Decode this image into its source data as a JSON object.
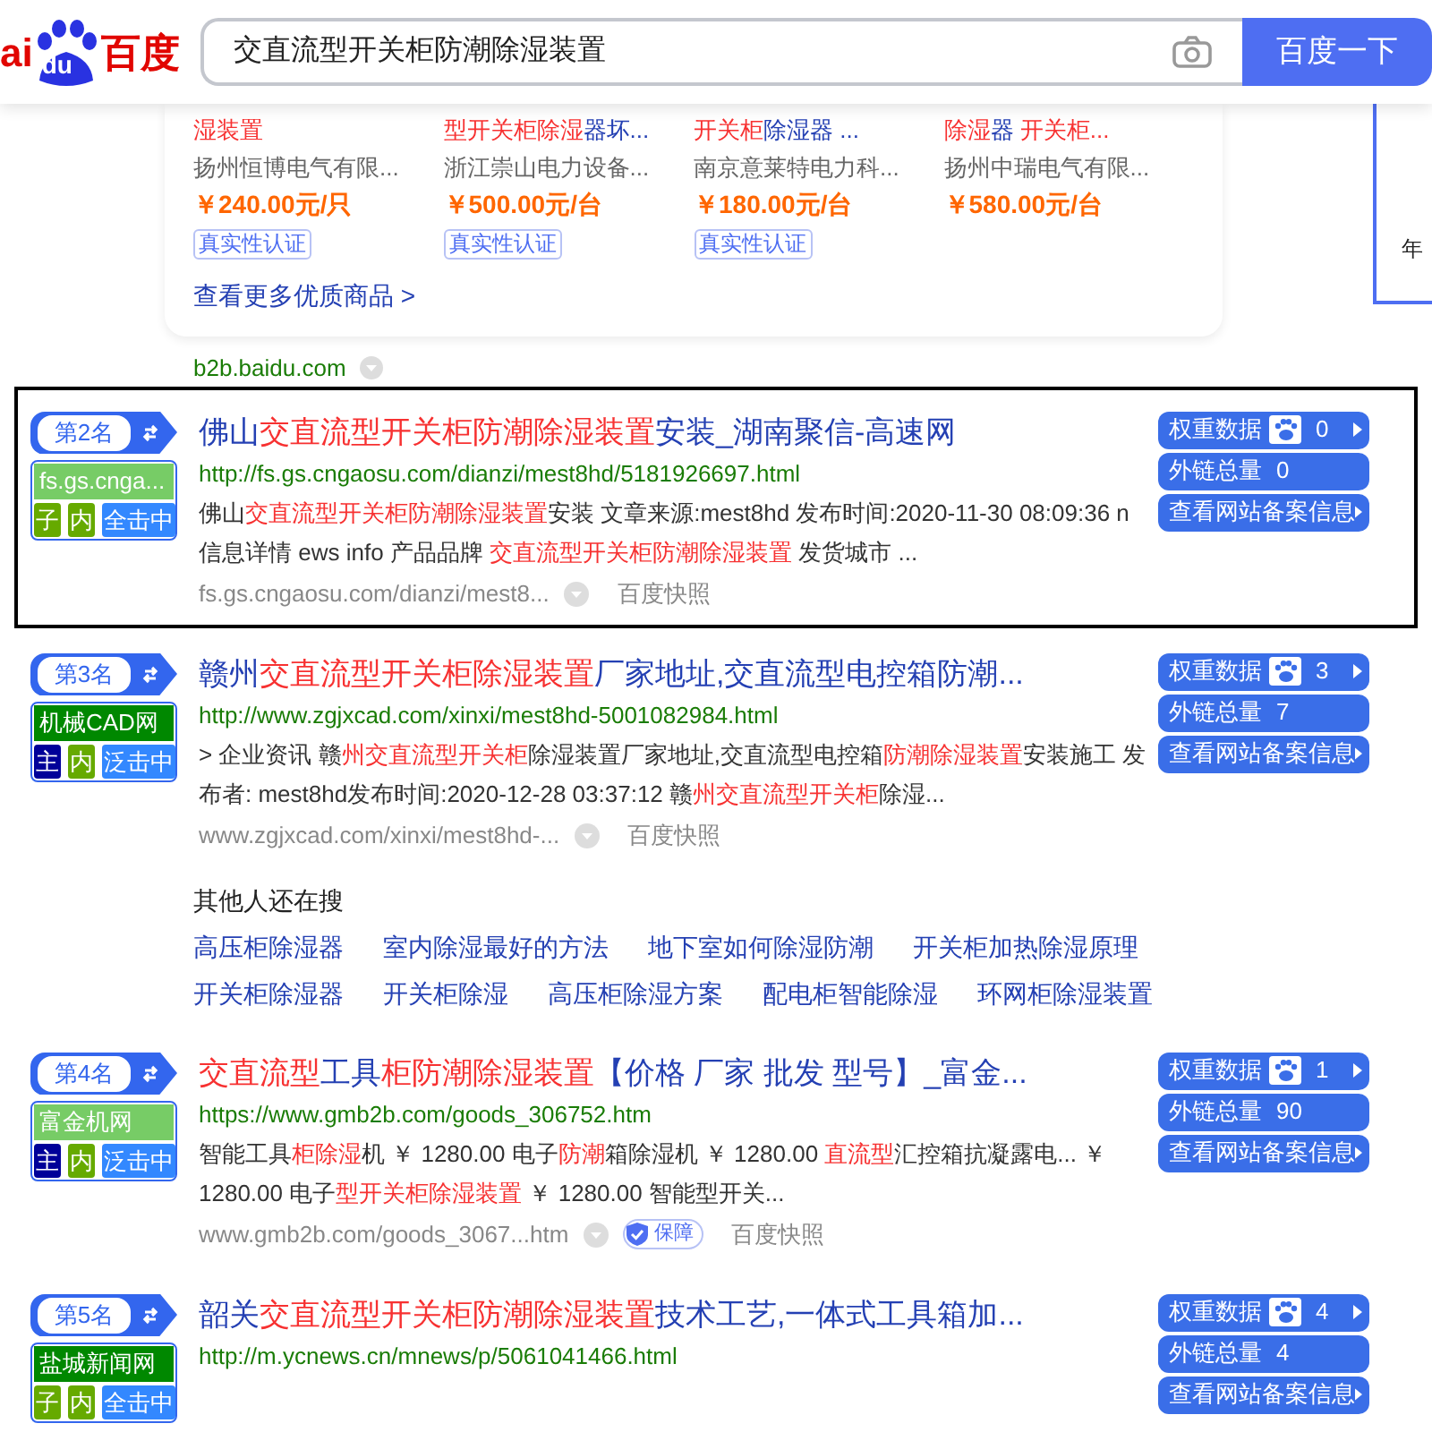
{
  "logo": {
    "left": "ai",
    "paw": "du",
    "right": "百度"
  },
  "search": {
    "value": "交直流型开关柜防潮除湿装置",
    "button": "百度一下"
  },
  "products": {
    "items": [
      {
        "title": [
          {
            "t": "湿装置",
            "hl": true
          }
        ],
        "seller": "扬州恒博电气有限...",
        "price": "￥240.00元/只",
        "badge": "真实性认证"
      },
      {
        "title": [
          {
            "t": "型开关柜除湿",
            "hl": true
          },
          {
            "t": "器坏...",
            "hl": false
          }
        ],
        "seller": "浙江崇山电力设备...",
        "price": "￥500.00元/台",
        "badge": "真实性认证"
      },
      {
        "title": [
          {
            "t": "开关柜",
            "hl": true
          },
          {
            "t": "除湿器 ...",
            "hl": false
          }
        ],
        "seller": "南京意莱特电力科...",
        "price": "￥180.00元/台",
        "badge": "真实性认证"
      },
      {
        "title": [
          {
            "t": "除湿",
            "hl": true
          },
          {
            "t": "器 ",
            "hl": false
          },
          {
            "t": "开关柜...",
            "hl": true
          }
        ],
        "seller": "扬州中瑞电气有限...",
        "price": "￥580.00元/台"
      }
    ],
    "more": "查看更多优质商品 >",
    "source": "b2b.baidu.com"
  },
  "side_box": {
    "text": "年"
  },
  "results": [
    {
      "framed": true,
      "rank": "第2名",
      "site": "fs.gs.cnga...",
      "color": "#77cc66",
      "tags": [
        {
          "t": "子",
          "color": "#66aa00"
        },
        {
          "t": "内",
          "color": "#66aa00"
        },
        {
          "t": "全击中",
          "color": "#3388ff"
        }
      ],
      "title": [
        {
          "t": "佛山",
          "hl": false
        },
        {
          "t": "交直流型开关柜防潮除湿装置",
          "hl": true
        },
        {
          "t": "安装_湖南聚信-高速网",
          "hl": false
        }
      ],
      "url": "http://fs.gs.cngaosu.com/dianzi/mest8hd/5181926697.html",
      "snippet": [
        {
          "t": "佛山",
          "hl": false
        },
        {
          "t": "交直流型开关柜防潮除湿装置",
          "hl": true
        },
        {
          "t": "安装 文章来源:mest8hd 发布时间:2020-11-30 08:09:36 n 信息详情 ews info 产品品牌 ",
          "hl": false
        },
        {
          "t": "交直流型开关柜防潮除湿装置",
          "hl": true
        },
        {
          "t": " 发货城市 ...",
          "hl": false
        }
      ],
      "cite": "fs.gs.cngaosu.com/dianzi/mest8...",
      "snapshot": "百度快照",
      "stats": {
        "weight_label": "权重数据",
        "weight": "0",
        "links_label": "外链总量",
        "links": "0",
        "record": "查看网站备案信息"
      }
    },
    {
      "framed": false,
      "rank": "第3名",
      "site": "机械CAD网",
      "color": "#008800",
      "tags": [
        {
          "t": "主",
          "color": "#000099"
        },
        {
          "t": "内",
          "color": "#66aa00"
        },
        {
          "t": "泛击中",
          "color": "#3388ff"
        }
      ],
      "title": [
        {
          "t": "赣州",
          "hl": false
        },
        {
          "t": "交直流型开关柜除湿装置",
          "hl": true
        },
        {
          "t": "厂家地址,交直流型电控箱防潮...",
          "hl": false
        }
      ],
      "url": "http://www.zgjxcad.com/xinxi/mest8hd-5001082984.html",
      "snippet": [
        {
          "t": "> 企业资讯 赣",
          "hl": false
        },
        {
          "t": "州交直流型开关柜",
          "hl": true
        },
        {
          "t": "除湿装置厂家地址,交直流型电控箱",
          "hl": false
        },
        {
          "t": "防潮除湿装置",
          "hl": true
        },
        {
          "t": "安装施工 发布者: mest8hd发布时间:2020-12-28 03:37:12 赣",
          "hl": false
        },
        {
          "t": "州交直流型开关柜",
          "hl": true
        },
        {
          "t": "除湿...",
          "hl": false
        }
      ],
      "cite": "www.zgjxcad.com/xinxi/mest8hd-...",
      "snapshot": "百度快照",
      "stats": {
        "weight_label": "权重数据",
        "weight": "3",
        "links_label": "外链总量",
        "links": "7",
        "record": "查看网站备案信息"
      }
    },
    {
      "framed": false,
      "rank": "第4名",
      "site": "富金机网",
      "color": "#77cc66",
      "tags": [
        {
          "t": "主",
          "color": "#000099"
        },
        {
          "t": "内",
          "color": "#66aa00"
        },
        {
          "t": "泛击中",
          "color": "#3388ff"
        }
      ],
      "title": [
        {
          "t": "交直流型",
          "hl": true
        },
        {
          "t": "工具",
          "hl": false
        },
        {
          "t": "柜防潮除湿装置",
          "hl": true
        },
        {
          "t": "【价格 厂家 批发 型号】_富金...",
          "hl": false
        }
      ],
      "url": "https://www.gmb2b.com/goods_306752.htm",
      "snippet": [
        {
          "t": "智能工具",
          "hl": false
        },
        {
          "t": "柜除湿",
          "hl": true
        },
        {
          "t": "机 ￥ 1280.00 电子",
          "hl": false
        },
        {
          "t": "防潮",
          "hl": true
        },
        {
          "t": "箱除湿机 ￥ 1280.00 ",
          "hl": false
        },
        {
          "t": "直流型",
          "hl": true
        },
        {
          "t": "汇控箱抗凝露电... ￥ 1280.00 电子",
          "hl": false
        },
        {
          "t": "型开关柜除湿装置",
          "hl": true
        },
        {
          "t": " ￥ 1280.00 智能型开关...",
          "hl": false
        }
      ],
      "cite": "www.gmb2b.com/goods_3067...htm",
      "guarantee": "保障",
      "snapshot": "百度快照",
      "stats": {
        "weight_label": "权重数据",
        "weight": "1",
        "links_label": "外链总量",
        "links": "90",
        "record": "查看网站备案信息"
      }
    },
    {
      "framed": false,
      "rank": "第5名",
      "site": "盐城新闻网",
      "color": "#008800",
      "tags": [
        {
          "t": "子",
          "color": "#66aa00"
        },
        {
          "t": "内",
          "color": "#66aa00"
        },
        {
          "t": "全击中",
          "color": "#3388ff"
        }
      ],
      "title": [
        {
          "t": "韶关",
          "hl": false
        },
        {
          "t": "交直流型开关柜防潮除湿装置",
          "hl": true
        },
        {
          "t": "技术工艺,一体式工具箱加...",
          "hl": false
        }
      ],
      "url": "http://m.ycnews.cn/mnews/p/5061041466.html",
      "stats": {
        "weight_label": "权重数据",
        "weight": "4",
        "links_label": "外链总量",
        "links": "4",
        "record": "查看网站备案信息"
      }
    }
  ],
  "related": {
    "title": "其他人还在搜",
    "rows": [
      [
        "高压柜除湿器",
        "室内除湿最好的方法",
        "地下室如何除湿防潮",
        "开关柜加热除湿原理"
      ],
      [
        "开关柜除湿器",
        "开关柜除湿",
        "高压柜除湿方案",
        "配电柜智能除湿",
        "环网柜除湿装置"
      ]
    ]
  }
}
